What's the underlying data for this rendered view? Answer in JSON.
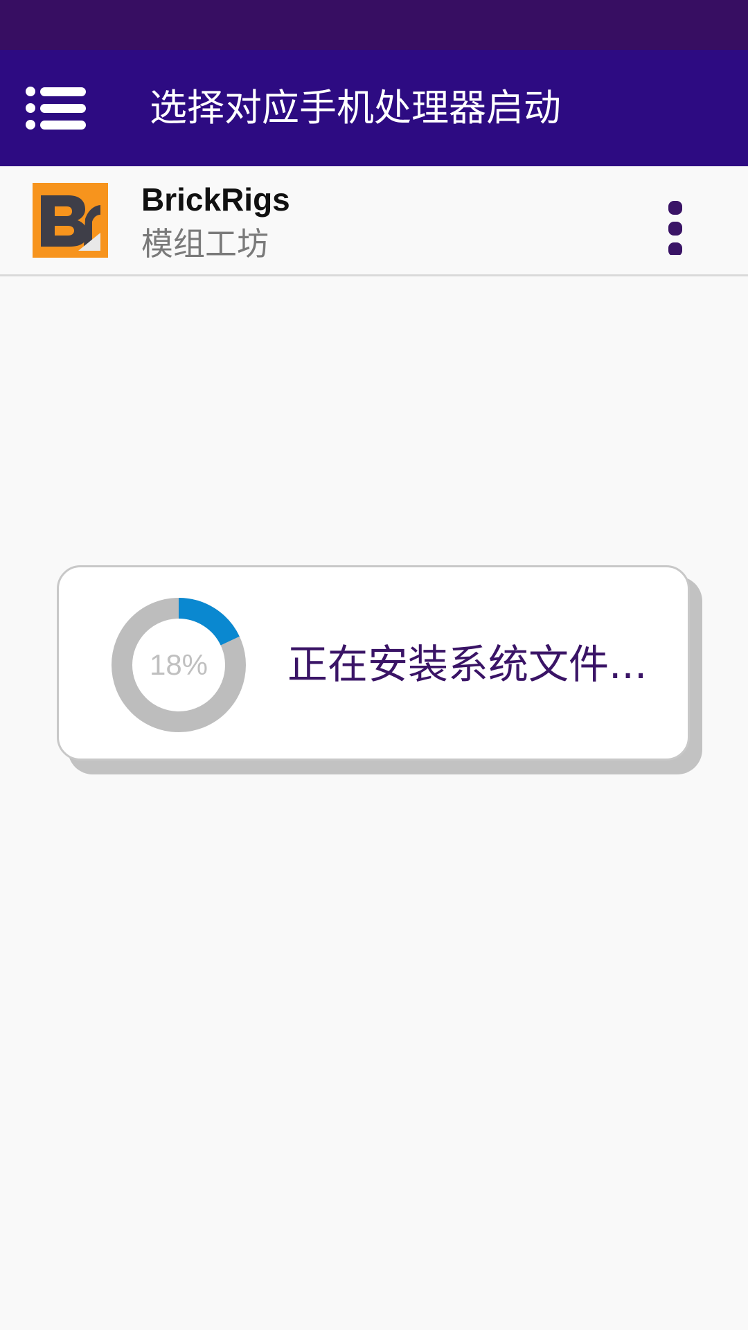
{
  "app_bar": {
    "title": "选择对应手机处理器启动",
    "menu_icon": "hamburger-menu-icon"
  },
  "app_row": {
    "name": "BrickRigs",
    "subtitle": "模组工坊",
    "logo_text": "B",
    "more_icon": "vertical-dots-icon"
  },
  "dialog": {
    "progress_value": 0.18,
    "progress_label": "18%",
    "message": "正在安装系统文件..."
  },
  "colors": {
    "status_bar": "#370e62",
    "app_bar": "#2d0b82",
    "accent_text": "#3a1466",
    "progress_fill": "#0a88d0",
    "progress_track": "#bdbdbd",
    "logo_bg": "#f7941d",
    "logo_fg": "#3e3e48"
  }
}
